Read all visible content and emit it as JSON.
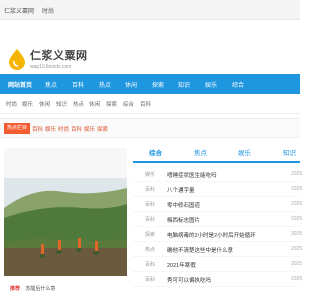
{
  "topbar": {
    "site_name": "仁浆义粟网",
    "time_link": "时尚"
  },
  "logo": {
    "title": "仁浆义粟网",
    "domain": "wap10.lbnzdx.com"
  },
  "mainnav": {
    "items": [
      "网站首页",
      "焦点",
      "百科",
      "热点",
      "休闲",
      "探索",
      "知识",
      "娱乐",
      "综合"
    ]
  },
  "subnav": {
    "items": [
      "时尚",
      "娱乐",
      "休闲",
      "知识",
      "热点",
      "休闲",
      "探索",
      "综合",
      "百科"
    ]
  },
  "tags": {
    "badge": "热点栏目",
    "items": [
      "百科",
      "娱乐",
      "时尚",
      "百科",
      "娱乐",
      "探索"
    ]
  },
  "feature": {
    "caption_label": "推荐",
    "caption_text": "苏醒后什么意"
  },
  "tabs": {
    "items": [
      "综合",
      "焦点",
      "娱乐",
      "知识"
    ]
  },
  "news": [
    {
      "cat": "娱乐",
      "title": "嗜睡症状医生能吃吗",
      "date": "2025"
    },
    {
      "cat": "百科",
      "title": "八个通字量",
      "date": "2025"
    },
    {
      "cat": "百科",
      "title": "零中修石国道",
      "date": "2025"
    },
    {
      "cat": "百科",
      "title": "梅西标志图片",
      "date": "2025"
    },
    {
      "cat": "探索",
      "title": "电脑病毒的2小时是2小时后开始循环",
      "date": "2025"
    },
    {
      "cat": "热点",
      "title": "确他不清楚这些中是什么意",
      "date": "2025"
    },
    {
      "cat": "百科",
      "title": "2021年寒假",
      "date": "2025"
    },
    {
      "cat": "百科",
      "title": "秀可可以偏执吃吗",
      "date": "2025"
    }
  ],
  "colors": {
    "nav_blue": "#1e96e0",
    "tag_orange": "#f35b30",
    "logo_yellow": "#f4b400"
  }
}
